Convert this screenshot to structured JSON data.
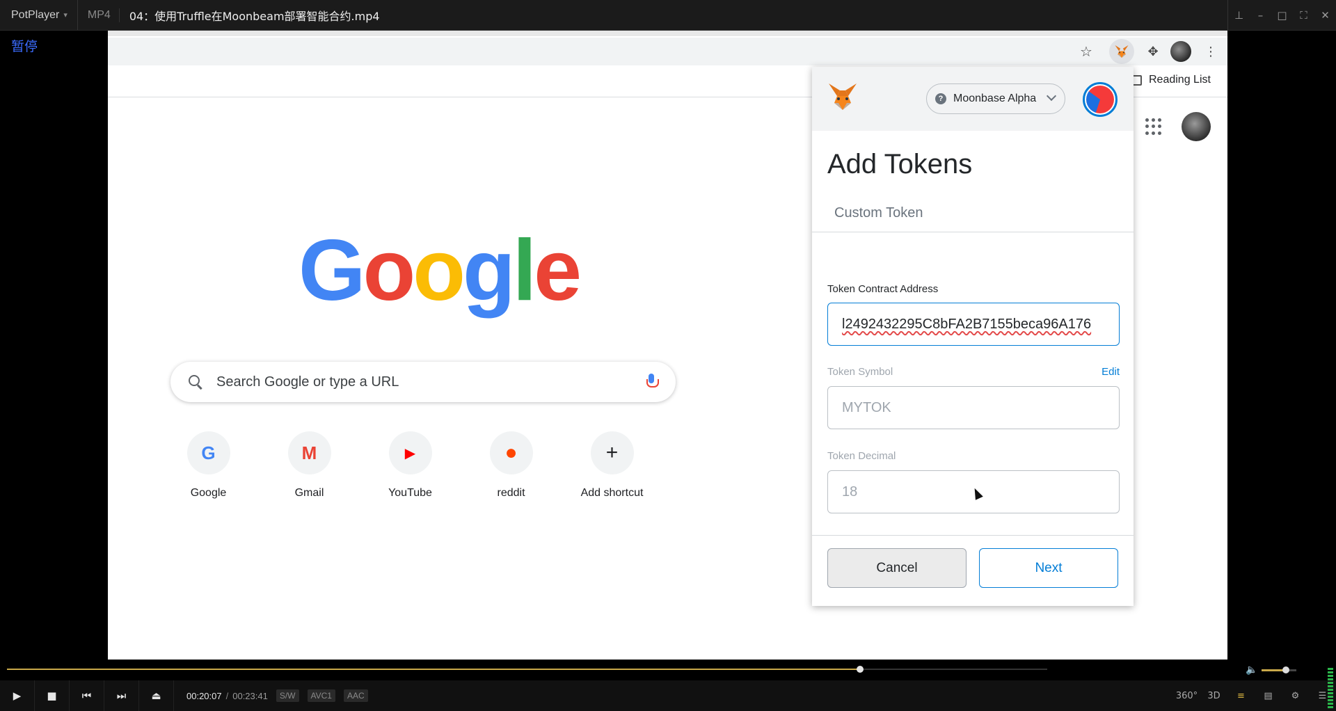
{
  "player": {
    "app_name": "PotPlayer",
    "format": "MP4",
    "file_title": "04：使用Truffle在Moonbeam部署智能合约.mp4",
    "status_label": "暂停",
    "time_current": "00:20:07",
    "time_separator": "/",
    "time_total": "00:23:41",
    "tag_sw": "S/W",
    "tag_video": "AVC1",
    "tag_audio": "AAC",
    "seek_progress": 0.82,
    "volume": 0.7,
    "right_controls": [
      "360°",
      "3D"
    ]
  },
  "browser": {
    "reading_list_label": "Reading List",
    "search_placeholder": "Search Google or type a URL",
    "google_logo_letters": [
      "G",
      "o",
      "o",
      "g",
      "l",
      "e"
    ],
    "shortcuts": [
      {
        "label": "Google",
        "icon": "google-icon",
        "glyph": "G",
        "color": "#4285f4"
      },
      {
        "label": "Gmail",
        "icon": "gmail-icon",
        "glyph": "M",
        "color": "#ea4335"
      },
      {
        "label": "YouTube",
        "icon": "youtube-icon",
        "glyph": "▶",
        "color": "#ff0000"
      },
      {
        "label": "reddit",
        "icon": "reddit-icon",
        "glyph": "●",
        "color": "#ff4500"
      },
      {
        "label": "Add shortcut",
        "icon": "plus-icon",
        "glyph": "+",
        "color": "#202124"
      }
    ]
  },
  "metamask": {
    "network_label": "Moonbase Alpha",
    "title": "Add Tokens",
    "tab_label": "Custom Token",
    "contract_label": "Token Contract Address",
    "contract_value": "l2492432295C8bFA2B7155beca96A176",
    "symbol_label": "Token Symbol",
    "symbol_edit": "Edit",
    "symbol_value": "MYTOK",
    "decimal_label": "Token Decimal",
    "decimal_value": "18",
    "cancel_label": "Cancel",
    "next_label": "Next",
    "accent_color": "#037dd6"
  }
}
